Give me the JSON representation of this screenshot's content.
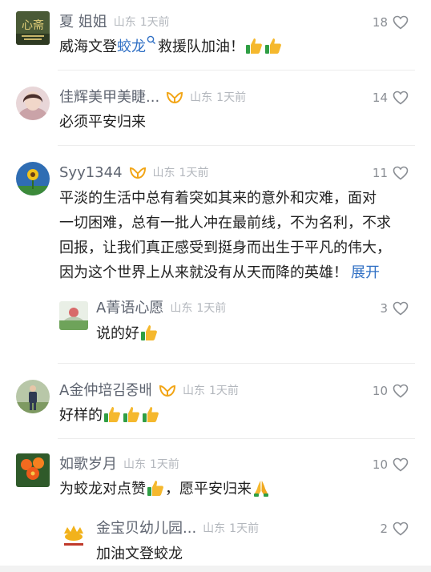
{
  "comments": [
    {
      "name": "夏 姐姐",
      "location": "山东",
      "time": "1天前",
      "likes": "18",
      "text_before": "威海文登",
      "tag": "蛟龙",
      "text_after": "救援队加油！",
      "avatar_text": "心斋"
    },
    {
      "name": "佳辉美甲美睫...",
      "location": "山东",
      "time": "1天前",
      "likes": "14",
      "text": "必须平安归来"
    },
    {
      "name": "Syy1344",
      "location": "山东",
      "time": "1天前",
      "likes": "11",
      "text_lines": [
        "平淡的生活中总有着突如其来的意外和灾难，面对",
        "一切困难，总有一批人冲在最前线，不为名利，不求",
        "回报，让我们真正感受到挺身而出生于平凡的伟大，",
        "因为这个世界上从来就没有从天而降的英雄！"
      ],
      "expand": "展开"
    },
    {
      "name": "A菁语心愿",
      "location": "山东",
      "time": "1天前",
      "likes": "3",
      "text": "说的好"
    },
    {
      "name": "A金仲培김중배",
      "location": "山东",
      "time": "1天前",
      "likes": "10",
      "text": "好样的"
    },
    {
      "name": "如歌岁月",
      "location": "山东",
      "time": "1天前",
      "likes": "10",
      "text_a": "为蛟龙对点赞",
      "text_b": "，愿平安归来"
    },
    {
      "name": "金宝贝幼儿园...",
      "location": "山东",
      "time": "1天前",
      "likes": "2",
      "text": "加油文登蛟龙"
    }
  ],
  "colors": {
    "link": "#2f6fc4",
    "badge": "#f2a516",
    "name": "#5e6470",
    "meta": "#b3b7bd"
  }
}
